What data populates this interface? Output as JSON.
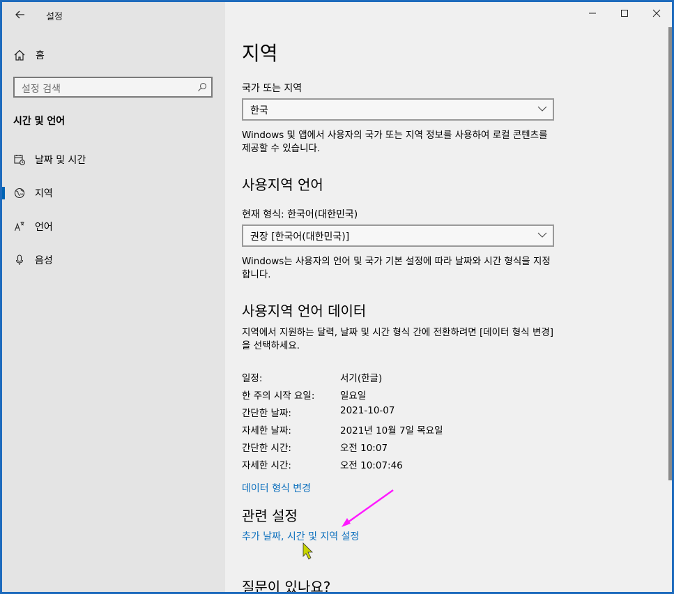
{
  "window": {
    "title": "설정",
    "controls": {
      "minimize": "—",
      "maximize": "☐",
      "close": "✕"
    }
  },
  "sidebar": {
    "home_label": "홈",
    "search_placeholder": "설정 검색",
    "section_title": "시간 및 언어",
    "items": [
      {
        "label": "날짜 및 시간",
        "icon": "calendar-clock-icon"
      },
      {
        "label": "지역",
        "icon": "globe-icon",
        "active": true
      },
      {
        "label": "언어",
        "icon": "language-icon"
      },
      {
        "label": "음성",
        "icon": "microphone-icon"
      }
    ]
  },
  "main": {
    "title": "지역",
    "country": {
      "label": "국가 또는 지역",
      "value": "한국",
      "description": "Windows 및 앱에서 사용자의 국가 또는 지역 정보를 사용하여 로컬 콘텐츠를 제공할 수 있습니다."
    },
    "regional_format": {
      "heading": "사용지역 언어",
      "current_label": "현재 형식: 한국어(대한민국)",
      "value": "권장 [한국어(대한민국)]",
      "description": "Windows는 사용자의 언어 및 국가 기본 설정에 따라 날짜와 시간 형식을 지정합니다."
    },
    "format_data": {
      "heading": "사용지역 언어 데이터",
      "description": "지역에서 지원하는 달력, 날짜 및 시간 형식 간에 전환하려면 [데이터 형식 변경]을 선택하세요.",
      "rows": [
        {
          "key": "일정:",
          "value": "서기(한글)"
        },
        {
          "key": "한 주의 시작 요일:",
          "value": "일요일"
        },
        {
          "key": "간단한 날짜:",
          "value": "2021-10-07"
        },
        {
          "key": "자세한 날짜:",
          "value": "2021년 10월 7일 목요일"
        },
        {
          "key": "간단한 시간:",
          "value": "오전 10:07"
        },
        {
          "key": "자세한 시간:",
          "value": "오전 10:07:46"
        }
      ],
      "change_link": "데이터 형식 변경"
    },
    "related": {
      "heading": "관련 설정",
      "link": "추가 날짜, 시간 및 지역 설정"
    },
    "questions_heading": "질문이 있나요?"
  },
  "colors": {
    "accent": "#0064b4",
    "link": "#0a6ebd",
    "annotation_arrow": "#ff19ff",
    "cursor": "#c8d400"
  }
}
